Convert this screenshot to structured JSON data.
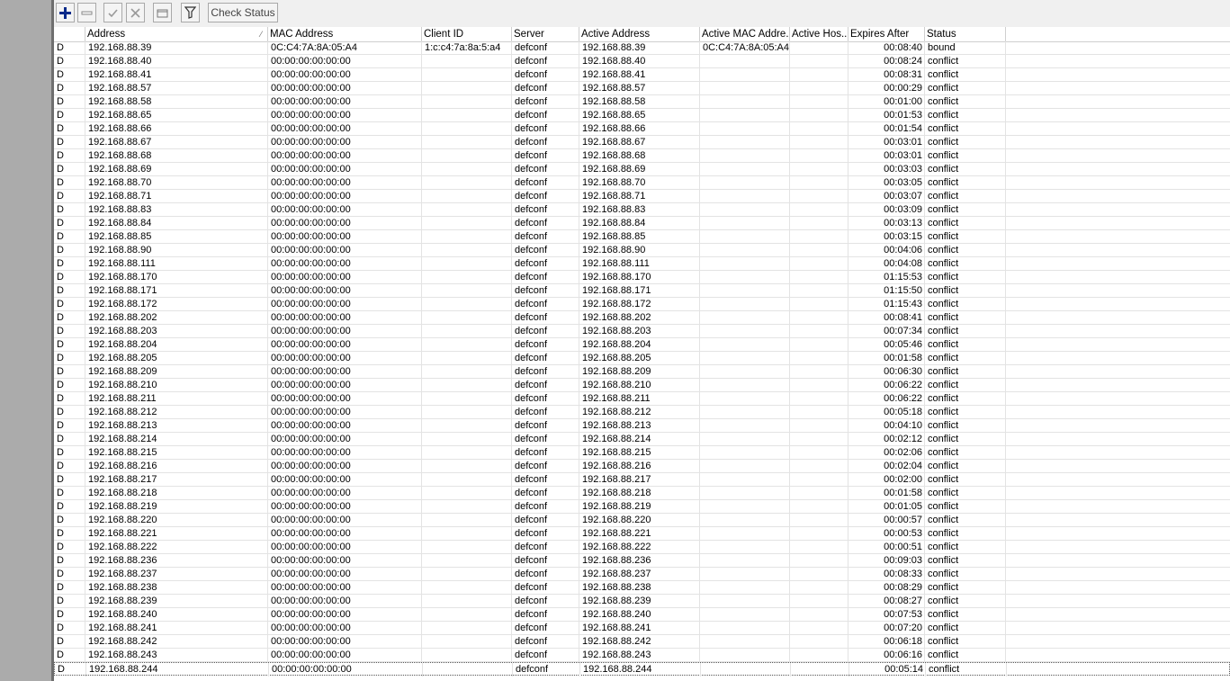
{
  "toolbar": {
    "add_icon": "plus-icon",
    "remove_icon": "minus-icon",
    "enable_icon": "check-icon",
    "disable_icon": "x-icon",
    "comment_icon": "comment-icon",
    "filter_icon": "filter-icon",
    "check_status_label": "Check Status"
  },
  "columns": {
    "flag": "",
    "address": "Address",
    "mac": "MAC Address",
    "client_id": "Client ID",
    "server": "Server",
    "active_address": "Active Address",
    "active_mac": "Active MAC Addre...",
    "active_host": "Active Hos...",
    "expires": "Expires After",
    "status": "Status"
  },
  "rows": [
    {
      "flag": "D",
      "address": "192.168.88.39",
      "mac": "0C:C4:7A:8A:05:A4",
      "client_id": "1:c:c4:7a:8a:5:a4",
      "server": "defconf",
      "active_address": "192.168.88.39",
      "active_mac": "0C:C4:7A:8A:05:A4",
      "active_host": "",
      "expires": "00:08:40",
      "status": "bound"
    },
    {
      "flag": "D",
      "address": "192.168.88.40",
      "mac": "00:00:00:00:00:00",
      "client_id": "",
      "server": "defconf",
      "active_address": "192.168.88.40",
      "active_mac": "",
      "active_host": "",
      "expires": "00:08:24",
      "status": "conflict"
    },
    {
      "flag": "D",
      "address": "192.168.88.41",
      "mac": "00:00:00:00:00:00",
      "client_id": "",
      "server": "defconf",
      "active_address": "192.168.88.41",
      "active_mac": "",
      "active_host": "",
      "expires": "00:08:31",
      "status": "conflict"
    },
    {
      "flag": "D",
      "address": "192.168.88.57",
      "mac": "00:00:00:00:00:00",
      "client_id": "",
      "server": "defconf",
      "active_address": "192.168.88.57",
      "active_mac": "",
      "active_host": "",
      "expires": "00:00:29",
      "status": "conflict"
    },
    {
      "flag": "D",
      "address": "192.168.88.58",
      "mac": "00:00:00:00:00:00",
      "client_id": "",
      "server": "defconf",
      "active_address": "192.168.88.58",
      "active_mac": "",
      "active_host": "",
      "expires": "00:01:00",
      "status": "conflict"
    },
    {
      "flag": "D",
      "address": "192.168.88.65",
      "mac": "00:00:00:00:00:00",
      "client_id": "",
      "server": "defconf",
      "active_address": "192.168.88.65",
      "active_mac": "",
      "active_host": "",
      "expires": "00:01:53",
      "status": "conflict"
    },
    {
      "flag": "D",
      "address": "192.168.88.66",
      "mac": "00:00:00:00:00:00",
      "client_id": "",
      "server": "defconf",
      "active_address": "192.168.88.66",
      "active_mac": "",
      "active_host": "",
      "expires": "00:01:54",
      "status": "conflict"
    },
    {
      "flag": "D",
      "address": "192.168.88.67",
      "mac": "00:00:00:00:00:00",
      "client_id": "",
      "server": "defconf",
      "active_address": "192.168.88.67",
      "active_mac": "",
      "active_host": "",
      "expires": "00:03:01",
      "status": "conflict"
    },
    {
      "flag": "D",
      "address": "192.168.88.68",
      "mac": "00:00:00:00:00:00",
      "client_id": "",
      "server": "defconf",
      "active_address": "192.168.88.68",
      "active_mac": "",
      "active_host": "",
      "expires": "00:03:01",
      "status": "conflict"
    },
    {
      "flag": "D",
      "address": "192.168.88.69",
      "mac": "00:00:00:00:00:00",
      "client_id": "",
      "server": "defconf",
      "active_address": "192.168.88.69",
      "active_mac": "",
      "active_host": "",
      "expires": "00:03:03",
      "status": "conflict"
    },
    {
      "flag": "D",
      "address": "192.168.88.70",
      "mac": "00:00:00:00:00:00",
      "client_id": "",
      "server": "defconf",
      "active_address": "192.168.88.70",
      "active_mac": "",
      "active_host": "",
      "expires": "00:03:05",
      "status": "conflict"
    },
    {
      "flag": "D",
      "address": "192.168.88.71",
      "mac": "00:00:00:00:00:00",
      "client_id": "",
      "server": "defconf",
      "active_address": "192.168.88.71",
      "active_mac": "",
      "active_host": "",
      "expires": "00:03:07",
      "status": "conflict"
    },
    {
      "flag": "D",
      "address": "192.168.88.83",
      "mac": "00:00:00:00:00:00",
      "client_id": "",
      "server": "defconf",
      "active_address": "192.168.88.83",
      "active_mac": "",
      "active_host": "",
      "expires": "00:03:09",
      "status": "conflict"
    },
    {
      "flag": "D",
      "address": "192.168.88.84",
      "mac": "00:00:00:00:00:00",
      "client_id": "",
      "server": "defconf",
      "active_address": "192.168.88.84",
      "active_mac": "",
      "active_host": "",
      "expires": "00:03:13",
      "status": "conflict"
    },
    {
      "flag": "D",
      "address": "192.168.88.85",
      "mac": "00:00:00:00:00:00",
      "client_id": "",
      "server": "defconf",
      "active_address": "192.168.88.85",
      "active_mac": "",
      "active_host": "",
      "expires": "00:03:15",
      "status": "conflict"
    },
    {
      "flag": "D",
      "address": "192.168.88.90",
      "mac": "00:00:00:00:00:00",
      "client_id": "",
      "server": "defconf",
      "active_address": "192.168.88.90",
      "active_mac": "",
      "active_host": "",
      "expires": "00:04:06",
      "status": "conflict"
    },
    {
      "flag": "D",
      "address": "192.168.88.111",
      "mac": "00:00:00:00:00:00",
      "client_id": "",
      "server": "defconf",
      "active_address": "192.168.88.111",
      "active_mac": "",
      "active_host": "",
      "expires": "00:04:08",
      "status": "conflict"
    },
    {
      "flag": "D",
      "address": "192.168.88.170",
      "mac": "00:00:00:00:00:00",
      "client_id": "",
      "server": "defconf",
      "active_address": "192.168.88.170",
      "active_mac": "",
      "active_host": "",
      "expires": "01:15:53",
      "status": "conflict"
    },
    {
      "flag": "D",
      "address": "192.168.88.171",
      "mac": "00:00:00:00:00:00",
      "client_id": "",
      "server": "defconf",
      "active_address": "192.168.88.171",
      "active_mac": "",
      "active_host": "",
      "expires": "01:15:50",
      "status": "conflict"
    },
    {
      "flag": "D",
      "address": "192.168.88.172",
      "mac": "00:00:00:00:00:00",
      "client_id": "",
      "server": "defconf",
      "active_address": "192.168.88.172",
      "active_mac": "",
      "active_host": "",
      "expires": "01:15:43",
      "status": "conflict"
    },
    {
      "flag": "D",
      "address": "192.168.88.202",
      "mac": "00:00:00:00:00:00",
      "client_id": "",
      "server": "defconf",
      "active_address": "192.168.88.202",
      "active_mac": "",
      "active_host": "",
      "expires": "00:08:41",
      "status": "conflict"
    },
    {
      "flag": "D",
      "address": "192.168.88.203",
      "mac": "00:00:00:00:00:00",
      "client_id": "",
      "server": "defconf",
      "active_address": "192.168.88.203",
      "active_mac": "",
      "active_host": "",
      "expires": "00:07:34",
      "status": "conflict"
    },
    {
      "flag": "D",
      "address": "192.168.88.204",
      "mac": "00:00:00:00:00:00",
      "client_id": "",
      "server": "defconf",
      "active_address": "192.168.88.204",
      "active_mac": "",
      "active_host": "",
      "expires": "00:05:46",
      "status": "conflict"
    },
    {
      "flag": "D",
      "address": "192.168.88.205",
      "mac": "00:00:00:00:00:00",
      "client_id": "",
      "server": "defconf",
      "active_address": "192.168.88.205",
      "active_mac": "",
      "active_host": "",
      "expires": "00:01:58",
      "status": "conflict"
    },
    {
      "flag": "D",
      "address": "192.168.88.209",
      "mac": "00:00:00:00:00:00",
      "client_id": "",
      "server": "defconf",
      "active_address": "192.168.88.209",
      "active_mac": "",
      "active_host": "",
      "expires": "00:06:30",
      "status": "conflict"
    },
    {
      "flag": "D",
      "address": "192.168.88.210",
      "mac": "00:00:00:00:00:00",
      "client_id": "",
      "server": "defconf",
      "active_address": "192.168.88.210",
      "active_mac": "",
      "active_host": "",
      "expires": "00:06:22",
      "status": "conflict"
    },
    {
      "flag": "D",
      "address": "192.168.88.211",
      "mac": "00:00:00:00:00:00",
      "client_id": "",
      "server": "defconf",
      "active_address": "192.168.88.211",
      "active_mac": "",
      "active_host": "",
      "expires": "00:06:22",
      "status": "conflict"
    },
    {
      "flag": "D",
      "address": "192.168.88.212",
      "mac": "00:00:00:00:00:00",
      "client_id": "",
      "server": "defconf",
      "active_address": "192.168.88.212",
      "active_mac": "",
      "active_host": "",
      "expires": "00:05:18",
      "status": "conflict"
    },
    {
      "flag": "D",
      "address": "192.168.88.213",
      "mac": "00:00:00:00:00:00",
      "client_id": "",
      "server": "defconf",
      "active_address": "192.168.88.213",
      "active_mac": "",
      "active_host": "",
      "expires": "00:04:10",
      "status": "conflict"
    },
    {
      "flag": "D",
      "address": "192.168.88.214",
      "mac": "00:00:00:00:00:00",
      "client_id": "",
      "server": "defconf",
      "active_address": "192.168.88.214",
      "active_mac": "",
      "active_host": "",
      "expires": "00:02:12",
      "status": "conflict"
    },
    {
      "flag": "D",
      "address": "192.168.88.215",
      "mac": "00:00:00:00:00:00",
      "client_id": "",
      "server": "defconf",
      "active_address": "192.168.88.215",
      "active_mac": "",
      "active_host": "",
      "expires": "00:02:06",
      "status": "conflict"
    },
    {
      "flag": "D",
      "address": "192.168.88.216",
      "mac": "00:00:00:00:00:00",
      "client_id": "",
      "server": "defconf",
      "active_address": "192.168.88.216",
      "active_mac": "",
      "active_host": "",
      "expires": "00:02:04",
      "status": "conflict"
    },
    {
      "flag": "D",
      "address": "192.168.88.217",
      "mac": "00:00:00:00:00:00",
      "client_id": "",
      "server": "defconf",
      "active_address": "192.168.88.217",
      "active_mac": "",
      "active_host": "",
      "expires": "00:02:00",
      "status": "conflict"
    },
    {
      "flag": "D",
      "address": "192.168.88.218",
      "mac": "00:00:00:00:00:00",
      "client_id": "",
      "server": "defconf",
      "active_address": "192.168.88.218",
      "active_mac": "",
      "active_host": "",
      "expires": "00:01:58",
      "status": "conflict"
    },
    {
      "flag": "D",
      "address": "192.168.88.219",
      "mac": "00:00:00:00:00:00",
      "client_id": "",
      "server": "defconf",
      "active_address": "192.168.88.219",
      "active_mac": "",
      "active_host": "",
      "expires": "00:01:05",
      "status": "conflict"
    },
    {
      "flag": "D",
      "address": "192.168.88.220",
      "mac": "00:00:00:00:00:00",
      "client_id": "",
      "server": "defconf",
      "active_address": "192.168.88.220",
      "active_mac": "",
      "active_host": "",
      "expires": "00:00:57",
      "status": "conflict"
    },
    {
      "flag": "D",
      "address": "192.168.88.221",
      "mac": "00:00:00:00:00:00",
      "client_id": "",
      "server": "defconf",
      "active_address": "192.168.88.221",
      "active_mac": "",
      "active_host": "",
      "expires": "00:00:53",
      "status": "conflict"
    },
    {
      "flag": "D",
      "address": "192.168.88.222",
      "mac": "00:00:00:00:00:00",
      "client_id": "",
      "server": "defconf",
      "active_address": "192.168.88.222",
      "active_mac": "",
      "active_host": "",
      "expires": "00:00:51",
      "status": "conflict"
    },
    {
      "flag": "D",
      "address": "192.168.88.236",
      "mac": "00:00:00:00:00:00",
      "client_id": "",
      "server": "defconf",
      "active_address": "192.168.88.236",
      "active_mac": "",
      "active_host": "",
      "expires": "00:09:03",
      "status": "conflict"
    },
    {
      "flag": "D",
      "address": "192.168.88.237",
      "mac": "00:00:00:00:00:00",
      "client_id": "",
      "server": "defconf",
      "active_address": "192.168.88.237",
      "active_mac": "",
      "active_host": "",
      "expires": "00:08:33",
      "status": "conflict"
    },
    {
      "flag": "D",
      "address": "192.168.88.238",
      "mac": "00:00:00:00:00:00",
      "client_id": "",
      "server": "defconf",
      "active_address": "192.168.88.238",
      "active_mac": "",
      "active_host": "",
      "expires": "00:08:29",
      "status": "conflict"
    },
    {
      "flag": "D",
      "address": "192.168.88.239",
      "mac": "00:00:00:00:00:00",
      "client_id": "",
      "server": "defconf",
      "active_address": "192.168.88.239",
      "active_mac": "",
      "active_host": "",
      "expires": "00:08:27",
      "status": "conflict"
    },
    {
      "flag": "D",
      "address": "192.168.88.240",
      "mac": "00:00:00:00:00:00",
      "client_id": "",
      "server": "defconf",
      "active_address": "192.168.88.240",
      "active_mac": "",
      "active_host": "",
      "expires": "00:07:53",
      "status": "conflict"
    },
    {
      "flag": "D",
      "address": "192.168.88.241",
      "mac": "00:00:00:00:00:00",
      "client_id": "",
      "server": "defconf",
      "active_address": "192.168.88.241",
      "active_mac": "",
      "active_host": "",
      "expires": "00:07:20",
      "status": "conflict"
    },
    {
      "flag": "D",
      "address": "192.168.88.242",
      "mac": "00:00:00:00:00:00",
      "client_id": "",
      "server": "defconf",
      "active_address": "192.168.88.242",
      "active_mac": "",
      "active_host": "",
      "expires": "00:06:18",
      "status": "conflict"
    },
    {
      "flag": "D",
      "address": "192.168.88.243",
      "mac": "00:00:00:00:00:00",
      "client_id": "",
      "server": "defconf",
      "active_address": "192.168.88.243",
      "active_mac": "",
      "active_host": "",
      "expires": "00:06:16",
      "status": "conflict"
    },
    {
      "flag": "D",
      "address": "192.168.88.244",
      "mac": "00:00:00:00:00:00",
      "client_id": "",
      "server": "defconf",
      "active_address": "192.168.88.244",
      "active_mac": "",
      "active_host": "",
      "expires": "00:05:14",
      "status": "conflict"
    }
  ],
  "colors": {
    "accent": "#0a2a8a",
    "grid_line": "#e3e3e3",
    "toolbar_bg": "#f0f0f0",
    "sidebar_bg": "#ababab"
  }
}
